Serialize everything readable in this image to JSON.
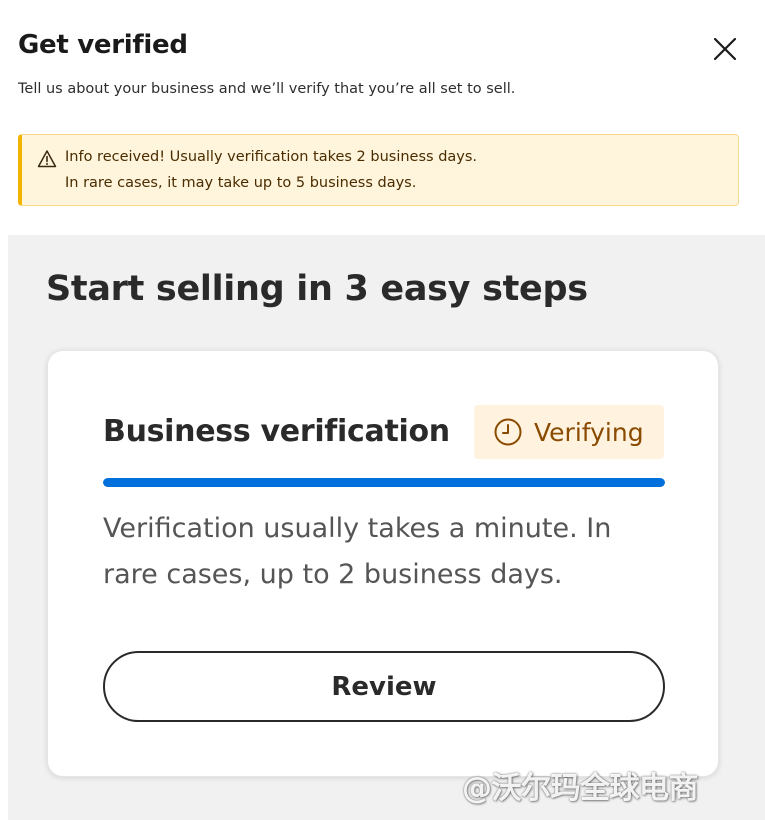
{
  "dialog": {
    "title": "Get verified",
    "subtitle": "Tell us about your business and we’ll verify that you’re all set to sell.",
    "close_icon": "close-icon"
  },
  "alert": {
    "icon": "warning-icon",
    "line1": "Info received! Usually verification takes 2 business days.",
    "line2": "In rare cases, it may take up to 5 business days.",
    "accent_color": "#f2b400",
    "background_color": "#fff5dc"
  },
  "main": {
    "heading": "Start selling in 3 easy steps"
  },
  "card": {
    "title": "Business verification",
    "status": {
      "label": "Verifying",
      "icon": "clock-icon",
      "color": "#8a4b00",
      "background_color": "#fff3df"
    },
    "progress": {
      "percent": 100,
      "color": "#0071dc"
    },
    "description": "Verification usually takes a minute. In rare cases, up to 2 business days.",
    "button_label": "Review"
  },
  "watermark": "@沃尔玛全球电商"
}
